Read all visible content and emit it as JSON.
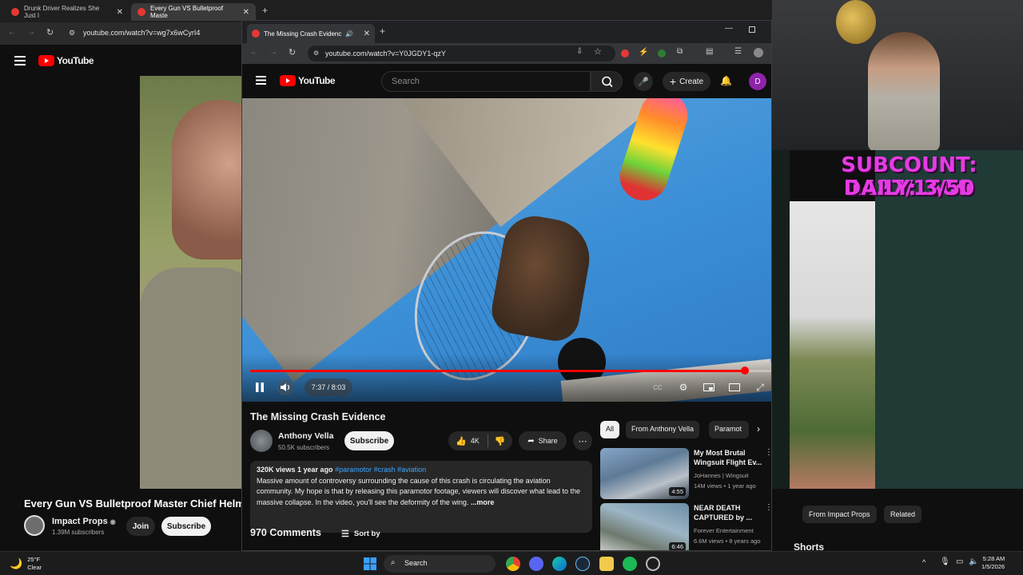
{
  "back_browser": {
    "tabs": [
      {
        "label": "Drunk Driver Realizes She Just I"
      },
      {
        "label": "Every Gun VS Bulletproof Maste"
      }
    ],
    "url": "youtube.com/watch?v=wg7x6wCyrI4",
    "logo": "YouTube",
    "video_title": "Every Gun VS Bulletproof Master Chief Helmet",
    "channel": "Impact Props",
    "subscribers": "1.39M subscribers",
    "join_label": "Join",
    "subscribe_label": "Subscribe"
  },
  "front_browser": {
    "tab_label": "The Missing Crash Evidenc",
    "url": "youtube.com/watch?v=Y0JGDY1-qzY",
    "logo": "YouTube",
    "search_placeholder": "Search",
    "create_label": "Create",
    "avatar_letter": "D",
    "player": {
      "time": "7:37 / 8:03",
      "progress": 0.947
    },
    "video_title": "The Missing Crash Evidence",
    "channel": "Anthony Vella",
    "subscribers": "50.5K subscribers",
    "subscribe_label": "Subscribe",
    "likes": "4K",
    "share_label": "Share",
    "description": {
      "meta": "320K views  1 year ago",
      "tags": "#paramotor #crash #aviation",
      "text": "Massive amount of controversy surrounding the cause of this crash is circulating the aviation community. My hope is that by releasing this paramotor footage, viewers will discover what lead to the massive collapse. In the video, you'll see the deformity of the wing.",
      "more": "...more"
    },
    "comments": "970 Comments",
    "sort_label": "Sort by",
    "chips": [
      "All",
      "From Anthony Vella",
      "Paramot"
    ],
    "recommendations": [
      {
        "title": "My Most Brutal Wingsuit Flight Ev...",
        "channel": "JoHannes | Wingsuit",
        "meta": "14M views • 1 year ago",
        "duration": "4:55"
      },
      {
        "title": "NEAR DEATH CAPTURED by ...",
        "channel": "Forever Entertainment",
        "meta": "6.6M views • 8 years ago",
        "duration": "6:46"
      }
    ]
  },
  "overlay": {
    "line1": "SUBCOUNT: 1427/1500",
    "line2": "DAILY: 3/50"
  },
  "right_panel": {
    "chips": [
      "From Impact Props",
      "Related"
    ],
    "shorts": "Shorts"
  },
  "taskbar": {
    "temp": "25°F",
    "condition": "Clear",
    "search": "Search",
    "time": "5:28 AM",
    "date": "1/5/2026"
  },
  "colors": {
    "youtube_red": "#ff0000",
    "overlay_magenta": "#e63be4"
  }
}
